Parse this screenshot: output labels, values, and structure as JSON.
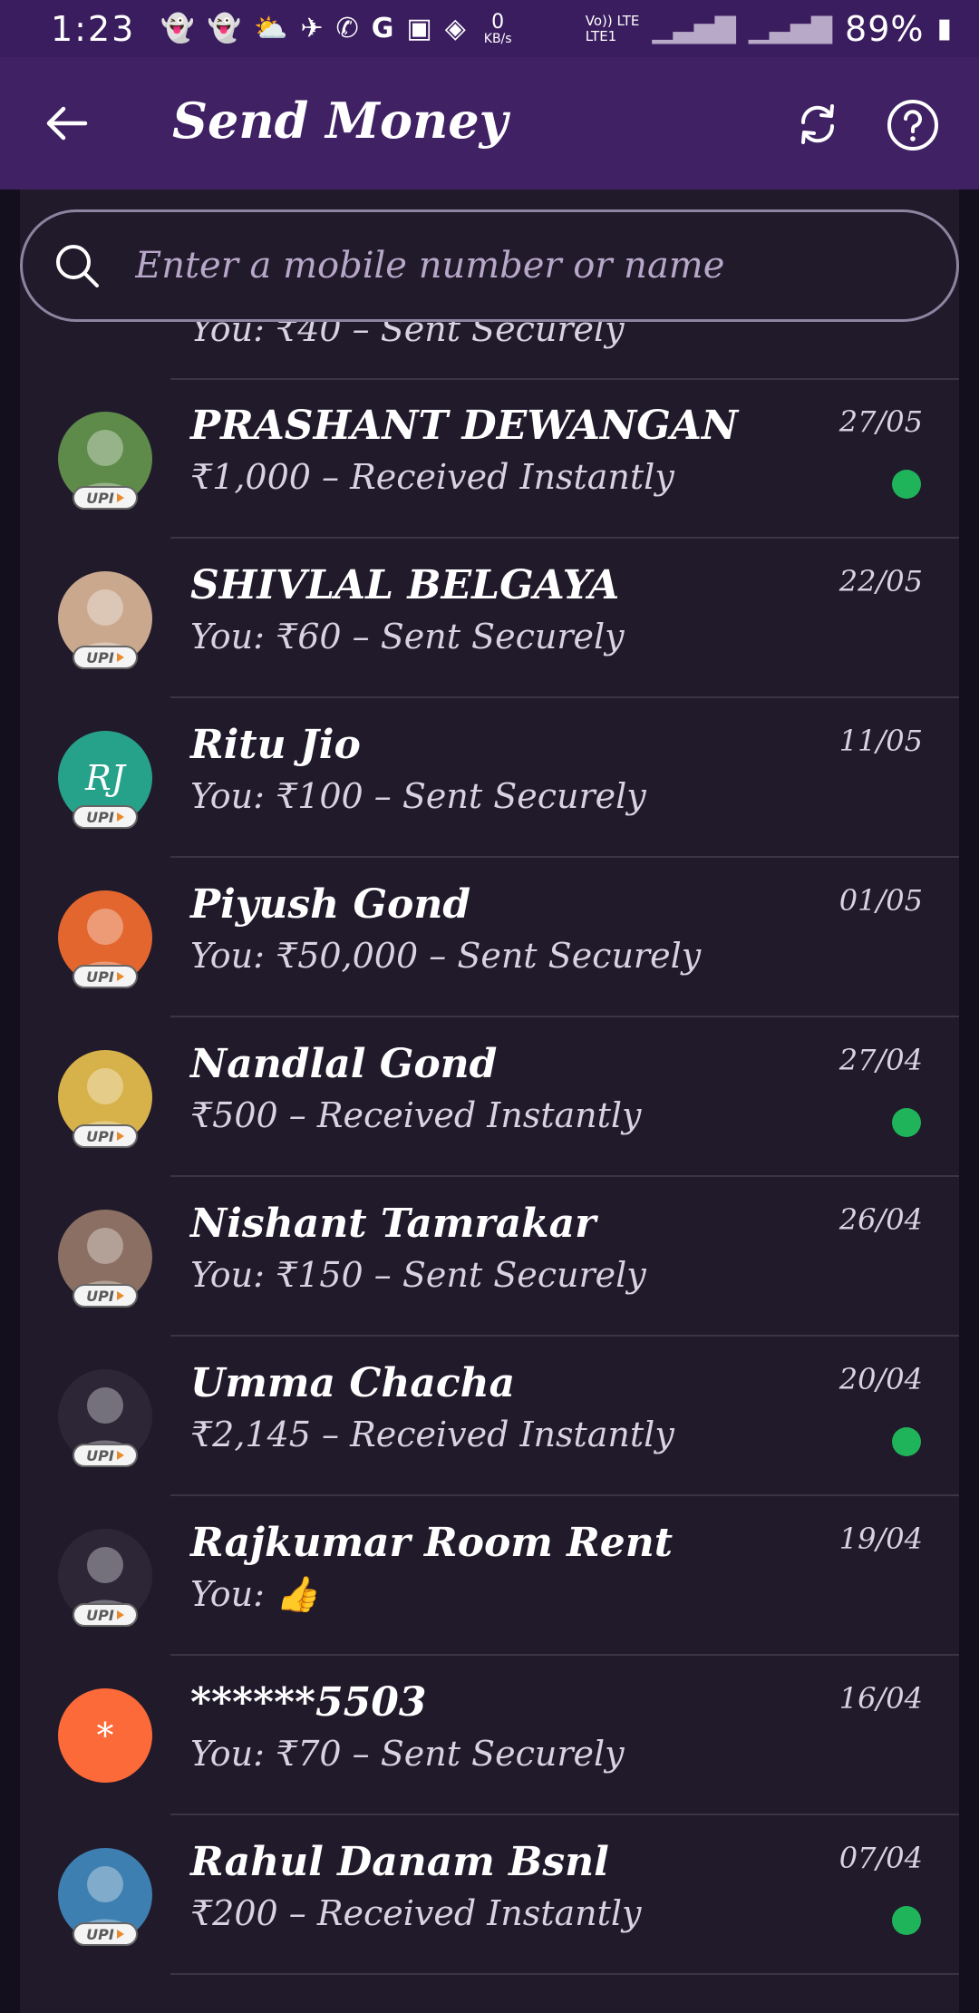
{
  "status_bar": {
    "time": "1:23",
    "net_speed": "0",
    "net_unit": "KB/s",
    "volte": "Vo)) LTE",
    "lte1": "LTE1",
    "battery": "89%"
  },
  "header": {
    "title": "Send Money"
  },
  "search": {
    "placeholder": "Enter a mobile number or name"
  },
  "partial_top": {
    "subtitle": "You: ₹40 – Sent Securely"
  },
  "contacts": [
    {
      "name": "PRASHANT  DEWANGAN",
      "subtitle": "₹1,000 – Received Instantly",
      "date": "27/05",
      "received": true,
      "avatar_color": "#5e8a4a",
      "initials": ""
    },
    {
      "name": "SHIVLAL BELGAYA",
      "subtitle": "You: ₹60 – Sent Securely",
      "date": "22/05",
      "received": false,
      "avatar_color": "#c9a88e",
      "initials": ""
    },
    {
      "name": "Ritu Jio",
      "subtitle": "You: ₹100 – Sent Securely",
      "date": "11/05",
      "received": false,
      "avatar_color": "#26a28a",
      "initials": "RJ"
    },
    {
      "name": "Piyush Gond",
      "subtitle": "You: ₹50,000 – Sent Securely",
      "date": "01/05",
      "received": false,
      "avatar_color": "#e2662d",
      "initials": ""
    },
    {
      "name": "Nandlal Gond",
      "subtitle": "₹500 – Received Instantly",
      "date": "27/04",
      "received": true,
      "avatar_color": "#d7b24a",
      "initials": ""
    },
    {
      "name": "Nishant Tamrakar",
      "subtitle": "You: ₹150 – Sent Securely",
      "date": "26/04",
      "received": false,
      "avatar_color": "#8a6f62",
      "initials": ""
    },
    {
      "name": "Umma Chacha",
      "subtitle": "₹2,145 – Received Instantly",
      "date": "20/04",
      "received": true,
      "avatar_color": "#2c2636",
      "initials": ""
    },
    {
      "name": "Rajkumar Room Rent",
      "subtitle": "You: 👍",
      "date": "19/04",
      "received": false,
      "avatar_color": "#2c2636",
      "initials": ""
    },
    {
      "name": "******5503",
      "subtitle": "You: ₹70 – Sent Securely",
      "date": "16/04",
      "received": false,
      "avatar_color": "#fb6a38",
      "initials": "*"
    },
    {
      "name": "Rahul Danam Bsnl",
      "subtitle": "₹200 – Received Instantly",
      "date": "07/04",
      "received": true,
      "avatar_color": "#3d7fb0",
      "initials": ""
    }
  ],
  "upi_label": "UPI"
}
